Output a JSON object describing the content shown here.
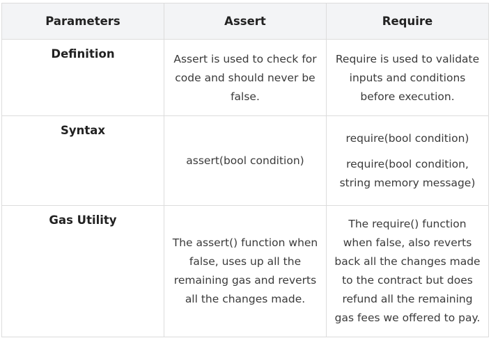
{
  "table": {
    "headers": [
      "Parameters",
      "Assert",
      "Require"
    ],
    "rows": [
      {
        "parameter": "Definition",
        "assert": "Assert is used to check for code and should never be false.",
        "require": "Require is used to validate inputs and conditions before execution."
      },
      {
        "parameter": "Syntax",
        "assert": "assert(bool condition)",
        "require": [
          "require(bool condition)",
          "require(bool condition, string memory message)"
        ]
      },
      {
        "parameter": "Gas Utility",
        "assert": "The assert() function when false, uses up all the remaining gas and reverts all the changes made.",
        "require": "The require() function when false, also reverts back all the changes made to the contract but does refund all the remaining gas fees we offered to pay."
      }
    ]
  },
  "colors": {
    "header_bg": "#f3f4f6",
    "border": "#dcdcdc",
    "text": "#3a3a3a"
  }
}
